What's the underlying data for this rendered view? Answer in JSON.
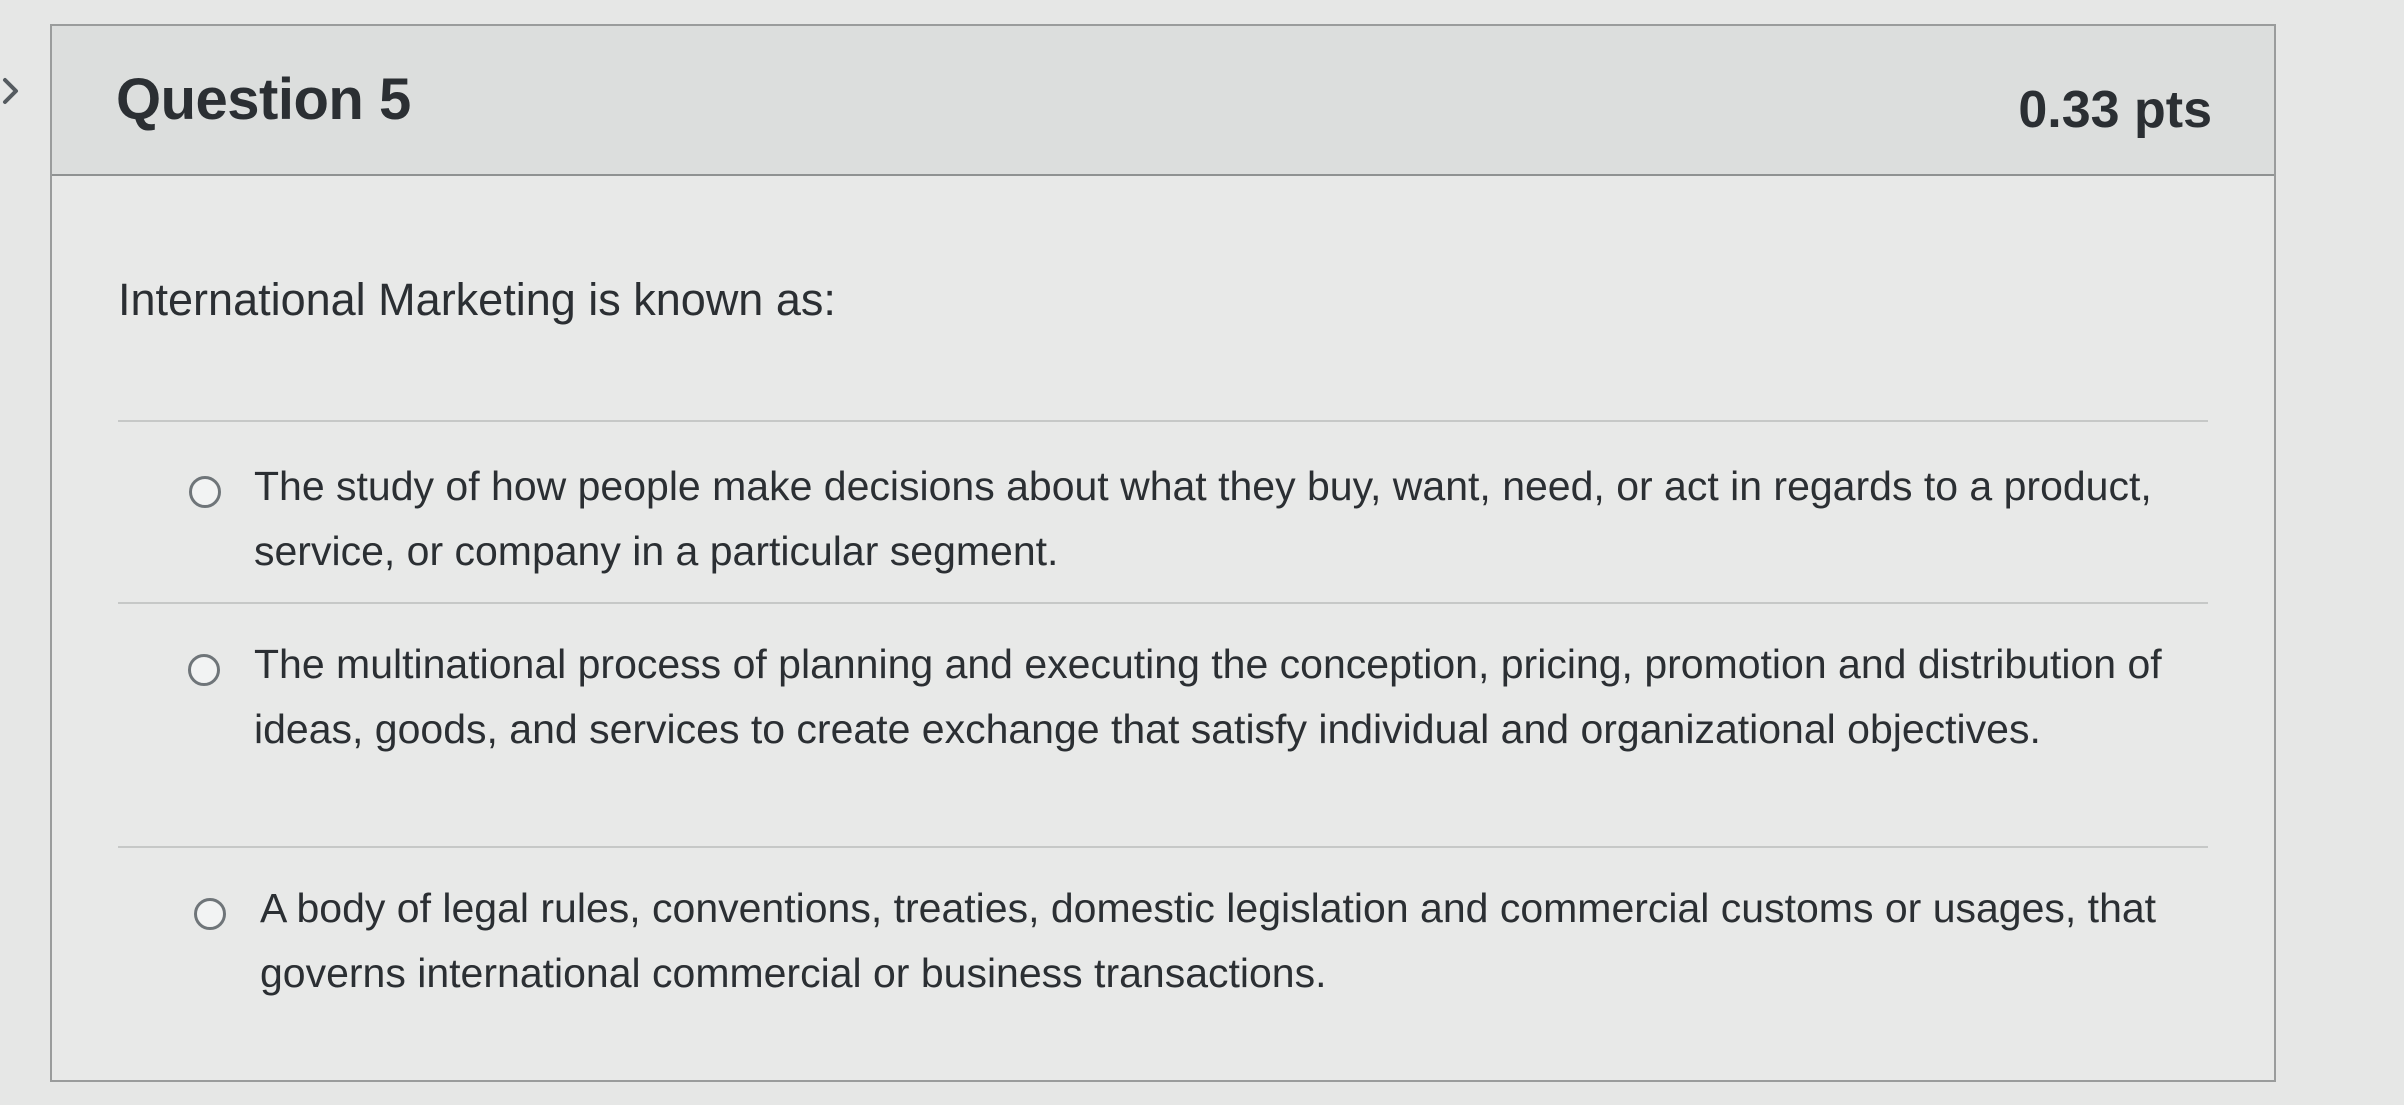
{
  "question": {
    "title": "Question 5",
    "points": "0.33 pts",
    "text": "International Marketing is known as:"
  },
  "answers": [
    {
      "text": "The study of how people make decisions about what they buy, want, need, or act in regards to a product, service, or company in a particular segment."
    },
    {
      "text": "The multinational process of planning and executing the conception, pricing, promotion and distribution of ideas, goods, and services to create exchange that satisfy individual and organizational objectives."
    },
    {
      "text": "A body of legal rules, conventions, treaties, domestic legislation and commercial customs or usages, that governs international commercial or business transactions."
    }
  ],
  "icons": {
    "collapse": "chevron-right-icon",
    "unselected_radio": "radio-unselected-icon"
  }
}
